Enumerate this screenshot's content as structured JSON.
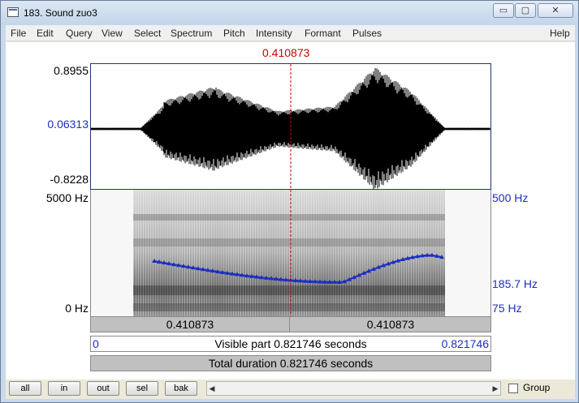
{
  "window": {
    "title": "183. Sound zuo3",
    "minimize_glyph": "▭",
    "maximize_glyph": "▢",
    "close_glyph": "✕"
  },
  "menu": [
    "File",
    "Edit",
    "Query",
    "View",
    "Select",
    "Spectrum",
    "Pitch",
    "Intensity",
    "Formant",
    "Pulses",
    "Help"
  ],
  "cursor": {
    "time_label": "0.410873"
  },
  "waveform": {
    "y_max": "0.8955",
    "y_mid": "0.06313",
    "y_min": "-0.8228"
  },
  "spectrogram": {
    "freq_max": "5000 Hz",
    "freq_min": "0 Hz",
    "pitch_max": "500 Hz",
    "pitch_current": "185.7 Hz",
    "pitch_min": "75 Hz"
  },
  "bars": {
    "left_segment": "0.410873",
    "right_segment": "0.410873",
    "visible_start": "0",
    "visible_label": "Visible part 0.821746 seconds",
    "visible_end": "0.821746",
    "total_label": "Total duration 0.821746 seconds"
  },
  "buttons": {
    "all": "all",
    "in": "in",
    "out": "out",
    "sel": "sel",
    "bak": "bak"
  },
  "group_label": "Group",
  "colors": {
    "cursor": "#cc0000",
    "pitch": "#1c2fbf",
    "axis_blue": "#1c2fbf"
  }
}
